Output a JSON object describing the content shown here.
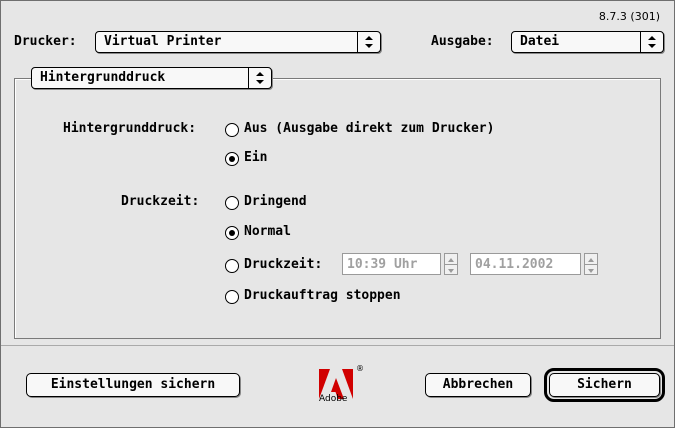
{
  "version": "8.7.3 (301)",
  "printer": {
    "label": "Drucker:",
    "value": "Virtual Printer"
  },
  "output": {
    "label": "Ausgabe:",
    "value": "Datei"
  },
  "section_popup": "Hintergrunddruck",
  "background": {
    "label": "Hintergrunddruck:",
    "options": [
      "Aus (Ausgabe direkt zum Drucker)",
      "Ein"
    ],
    "selected": "Ein"
  },
  "print_time": {
    "label": "Druckzeit:",
    "options": [
      "Dringend",
      "Normal",
      "Druckzeit:",
      "Druckauftrag stoppen"
    ],
    "selected": "Normal",
    "time_value": "10:39 Uhr",
    "date_value": "04.11.2002"
  },
  "buttons": {
    "save_settings": "Einstellungen sichern",
    "cancel": "Abbrechen",
    "save": "Sichern"
  },
  "logo": {
    "text": "Adobe",
    "reg": "®"
  },
  "icons": [
    "popup-arrows-icon",
    "stepper-icon",
    "adobe-logo-icon"
  ],
  "colors": {
    "background": "#e6e6e6",
    "disabled_text": "#a0a0a0"
  }
}
